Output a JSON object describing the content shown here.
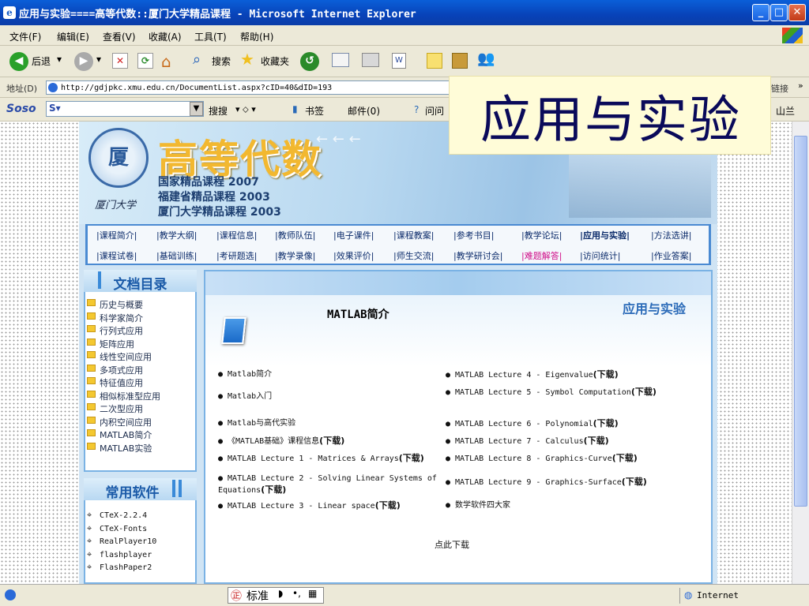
{
  "window": {
    "title": "应用与实验====高等代数::厦门大学精品课程 - Microsoft Internet Explorer",
    "min": "_",
    "max": "□",
    "close": "✕"
  },
  "menubar": {
    "items": [
      "文件(F)",
      "编辑(E)",
      "查看(V)",
      "收藏(A)",
      "工具(T)",
      "帮助(H)"
    ]
  },
  "toolbar": {
    "back": "后退",
    "search": "搜索",
    "favorites": "收藏夹"
  },
  "address": {
    "label": "地址(D)",
    "url": "http://gdjpkc.xmu.edu.cn/DocumentList.aspx?cID=40&dID=193",
    "links": "链接"
  },
  "sosobar": {
    "logo": "Soso",
    "search_btn": "搜搜",
    "bookmark": "书签",
    "mail": "邮件(0)",
    "ask": "问问",
    "right_text": "山兰"
  },
  "overlay_title": "应用与实验",
  "banner": {
    "title": "高等代数",
    "lines": [
      "国家精品课程 2007",
      "福建省精品课程 2003",
      "厦门大学精品课程 2003"
    ],
    "signature": "厦门大学"
  },
  "nav": {
    "row1": [
      "|课程简介|",
      "|教学大纲|",
      "|课程信息|",
      "|教师队伍|",
      "|电子课件|",
      "|课程教案|",
      "|参考书目|",
      "|教学论坛|",
      "|应用与实验|",
      "|方法选讲|"
    ],
    "row2": [
      "|课程试卷|",
      "|基础训练|",
      "|考研题选|",
      "|教学录像|",
      "|效果评价|",
      "|师生交流|",
      "|教学研讨会|",
      "|难题解答|",
      "|访问统计|",
      "|作业答案|"
    ]
  },
  "doc_catalog": {
    "title": "文档目录",
    "items": [
      "历史与概要",
      "科学家简介",
      "行列式应用",
      "矩阵应用",
      "线性空间应用",
      "多项式应用",
      "特征值应用",
      "相似标准型应用",
      "二次型应用",
      "内积空间应用",
      "MATLAB简介",
      "MATLAB实验"
    ]
  },
  "software": {
    "title": "常用软件",
    "items": [
      "CTeX-2.2.4",
      "CTeX-Fonts",
      "RealPlayer10",
      "flashplayer",
      "FlashPaper2"
    ]
  },
  "content": {
    "heading": "MATLAB简介",
    "section_tag": "应用与实验",
    "download_all": "点此下载",
    "left_links": [
      "● Matlab简介",
      "● Matlab入门",
      "● Matlab与高代实验",
      "● 《MATLAB基础》课程信息",
      "● MATLAB Lecture 1 - Matrices & Arrays",
      "● MATLAB Lecture 2 - Solving Linear Systems of Equations",
      "● MATLAB Lecture 3 - Linear space"
    ],
    "right_links": [
      "● MATLAB Lecture 4 - Eigenvalue",
      "● MATLAB Lecture 5 - Symbol Computation",
      "● MATLAB Lecture 6 - Polynomial",
      "● MATLAB Lecture 7 - Calculus",
      "● MATLAB Lecture 8 - Graphics-Curve",
      "● MATLAB Lecture 9 - Graphics-Surface",
      "● 数学软件四大家"
    ],
    "download_label": "(下载)"
  },
  "statusbar": {
    "ime": "标准",
    "zone": "Internet"
  }
}
